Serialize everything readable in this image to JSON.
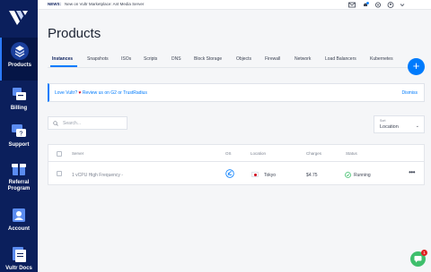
{
  "sidebar": {
    "items": [
      {
        "label": "Products",
        "icon": "cube-stack-icon"
      },
      {
        "label": "Billing",
        "icon": "billing-icon"
      },
      {
        "label": "Support",
        "icon": "support-icon"
      },
      {
        "label": "Referral Program",
        "icon": "referral-gift-icon"
      },
      {
        "label": "Account",
        "icon": "account-icon"
      },
      {
        "label": "Vultr Docs",
        "icon": "docs-icon"
      }
    ]
  },
  "topbar": {
    "news_tag": "NEWS:",
    "news_text": "New on Vultr Marketplace: Ant Media Server",
    "notification_count": "1"
  },
  "page": {
    "title": "Products"
  },
  "tabs": [
    "Instances",
    "Snapshots",
    "ISOs",
    "Scripts",
    "DNS",
    "Block Storage",
    "Objects",
    "Firewall",
    "Network",
    "Load Balancers",
    "Kubernetes"
  ],
  "banner": {
    "text_before": "Love Vultr?",
    "heart": "♥",
    "text_after": "Review us on G2 or TrustRadius",
    "dismiss": "Dismiss"
  },
  "search": {
    "placeholder": "Search..."
  },
  "sort": {
    "caption": "Sort",
    "value": "Location"
  },
  "table": {
    "headers": {
      "server": "Server",
      "os": "OS",
      "location": "Location",
      "charges": "Charges",
      "status": "Status"
    },
    "rows": [
      {
        "server": "1 vCPU High Frequency -",
        "location": "Tokyo",
        "charges": "$4.75",
        "status": "Running"
      }
    ]
  },
  "chat": {
    "badge": "1"
  },
  "colors": {
    "sidebar": "#0b1f5c",
    "accent": "#007bfc",
    "running": "#3fbf6c"
  }
}
